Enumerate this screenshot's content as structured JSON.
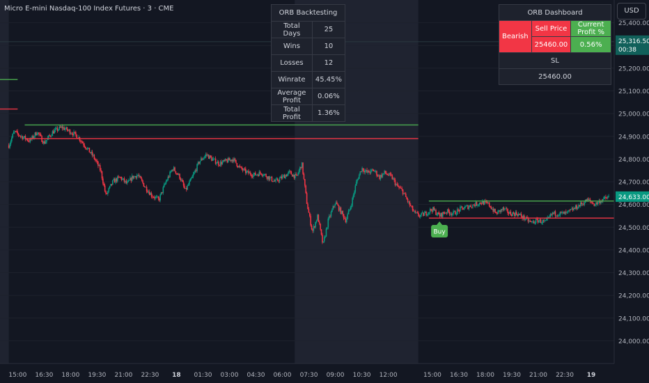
{
  "header": {
    "symbol_title": "Micro E-mini Nasdaq-100 Index Futures · 3 · CME",
    "currency_button": "USD"
  },
  "colors": {
    "background": "#131722",
    "session_shade": "#1f2330",
    "up_candle": "#089981",
    "down_candle": "#f23645",
    "range_high": "#4caf50",
    "range_low": "#f23645",
    "grid": "#1e222d"
  },
  "backtest": {
    "title": "ORB Backtesting",
    "rows": [
      {
        "label": "Total Days",
        "value": "25"
      },
      {
        "label": "Wins",
        "value": "10"
      },
      {
        "label": "Losses",
        "value": "12"
      },
      {
        "label": "Winrate",
        "value": "45.45%"
      },
      {
        "label": "Average Profit",
        "value": "0.06%"
      },
      {
        "label": "Total Profit",
        "value": "1.36%"
      }
    ]
  },
  "dashboard": {
    "title": "ORB Dashboard",
    "bias": "Bearish",
    "sell_price_label": "Sell Price",
    "current_profit_label": "Current Profit %",
    "sell_price": "25460.00",
    "current_profit": "0.56%",
    "sl_label": "SL",
    "sl_value": "25460.00"
  },
  "chart_data": {
    "type": "candlestick",
    "ylim": [
      23900,
      25500
    ],
    "y_ticks": [
      24000,
      24100,
      24200,
      24300,
      24400,
      24500,
      24600,
      24700,
      24800,
      24900,
      25000,
      25100,
      25200,
      25300,
      25400
    ],
    "y_tick_labels": [
      "24,000.00",
      "24,100.00",
      "24,200.00",
      "24,300.00",
      "24,400.00",
      "24,500.00",
      "24,600.00",
      "24,700.00",
      "24,800.00",
      "24,900.00",
      "25,000.00",
      "25,100.00",
      "25,200.00",
      "25,300.00",
      "25,400.00"
    ],
    "x_ticks": [
      {
        "t": 0.5,
        "label": "15:00"
      },
      {
        "t": 2.0,
        "label": "16:30"
      },
      {
        "t": 3.5,
        "label": "18:00"
      },
      {
        "t": 5.0,
        "label": "19:30"
      },
      {
        "t": 6.5,
        "label": "21:00"
      },
      {
        "t": 8.0,
        "label": "22:30"
      },
      {
        "t": 9.5,
        "label": "18"
      },
      {
        "t": 11.0,
        "label": "01:30"
      },
      {
        "t": 12.5,
        "label": "03:00"
      },
      {
        "t": 14.0,
        "label": "04:30"
      },
      {
        "t": 15.5,
        "label": "06:00"
      },
      {
        "t": 17.0,
        "label": "07:30"
      },
      {
        "t": 18.5,
        "label": "09:00"
      },
      {
        "t": 20.0,
        "label": "10:30"
      },
      {
        "t": 21.5,
        "label": "12:00"
      },
      {
        "t": 24.0,
        "label": "15:00"
      },
      {
        "t": 25.5,
        "label": "16:30"
      },
      {
        "t": 27.0,
        "label": "18:00"
      },
      {
        "t": 28.5,
        "label": "19:30"
      },
      {
        "t": 30.0,
        "label": "21:00"
      },
      {
        "t": 31.5,
        "label": "22:30"
      },
      {
        "t": 33.0,
        "label": "19"
      }
    ],
    "x_range": [
      -0.5,
      34.3
    ],
    "session_shades": [
      [
        -0.5,
        0.0
      ],
      [
        16.2,
        23.2
      ]
    ],
    "price_path": [
      [
        0.0,
        24860
      ],
      [
        0.3,
        24920
      ],
      [
        0.7,
        24900
      ],
      [
        1.2,
        24880
      ],
      [
        1.6,
        24920
      ],
      [
        2.0,
        24870
      ],
      [
        2.5,
        24920
      ],
      [
        3.0,
        24940
      ],
      [
        3.5,
        24920
      ],
      [
        3.9,
        24900
      ],
      [
        4.3,
        24860
      ],
      [
        4.8,
        24810
      ],
      [
        5.2,
        24750
      ],
      [
        5.5,
        24640
      ],
      [
        5.9,
        24700
      ],
      [
        6.3,
        24720
      ],
      [
        6.7,
        24690
      ],
      [
        7.0,
        24720
      ],
      [
        7.3,
        24730
      ],
      [
        7.7,
        24680
      ],
      [
        8.1,
        24640
      ],
      [
        8.5,
        24620
      ],
      [
        8.9,
        24700
      ],
      [
        9.3,
        24760
      ],
      [
        9.7,
        24720
      ],
      [
        10.0,
        24660
      ],
      [
        10.4,
        24720
      ],
      [
        10.8,
        24790
      ],
      [
        11.2,
        24820
      ],
      [
        11.5,
        24800
      ],
      [
        11.9,
        24780
      ],
      [
        12.3,
        24790
      ],
      [
        12.7,
        24800
      ],
      [
        13.1,
        24760
      ],
      [
        13.5,
        24740
      ],
      [
        13.9,
        24730
      ],
      [
        14.3,
        24740
      ],
      [
        14.7,
        24720
      ],
      [
        15.1,
        24700
      ],
      [
        15.5,
        24720
      ],
      [
        15.9,
        24740
      ],
      [
        16.3,
        24720
      ],
      [
        16.6,
        24780
      ],
      [
        16.9,
        24600
      ],
      [
        17.2,
        24480
      ],
      [
        17.5,
        24550
      ],
      [
        17.8,
        24420
      ],
      [
        18.1,
        24530
      ],
      [
        18.5,
        24610
      ],
      [
        18.8,
        24570
      ],
      [
        19.1,
        24530
      ],
      [
        19.4,
        24600
      ],
      [
        19.7,
        24700
      ],
      [
        20.0,
        24760
      ],
      [
        20.3,
        24740
      ],
      [
        20.7,
        24750
      ],
      [
        21.0,
        24720
      ],
      [
        21.3,
        24740
      ],
      [
        21.7,
        24720
      ],
      [
        22.0,
        24680
      ],
      [
        22.3,
        24660
      ],
      [
        22.7,
        24600
      ],
      [
        23.0,
        24560
      ],
      [
        23.3,
        24550
      ],
      [
        23.6,
        24560
      ],
      [
        24.0,
        24580
      ],
      [
        24.4,
        24550
      ],
      [
        24.8,
        24570
      ],
      [
        25.2,
        24560
      ],
      [
        25.6,
        24580
      ],
      [
        26.0,
        24590
      ],
      [
        26.4,
        24600
      ],
      [
        26.8,
        24610
      ],
      [
        27.2,
        24600
      ],
      [
        27.6,
        24560
      ],
      [
        28.0,
        24580
      ],
      [
        28.4,
        24560
      ],
      [
        28.8,
        24560
      ],
      [
        29.2,
        24540
      ],
      [
        29.6,
        24520
      ],
      [
        30.0,
        24530
      ],
      [
        30.4,
        24520
      ],
      [
        30.8,
        24560
      ],
      [
        31.2,
        24560
      ],
      [
        31.6,
        24560
      ],
      [
        32.0,
        24580
      ],
      [
        32.4,
        24600
      ],
      [
        32.8,
        24620
      ],
      [
        33.2,
        24600
      ],
      [
        33.6,
        24620
      ],
      [
        34.0,
        24633
      ]
    ],
    "range_lines": [
      {
        "kind": "high",
        "price": 25150,
        "x": [
          -0.5,
          0.5
        ]
      },
      {
        "kind": "low",
        "price": 25020,
        "x": [
          -0.5,
          0.5
        ]
      },
      {
        "kind": "high",
        "price": 24950,
        "x": [
          0.9,
          23.2
        ]
      },
      {
        "kind": "low",
        "price": 24890,
        "x": [
          0.9,
          23.2
        ]
      },
      {
        "kind": "high",
        "price": 24615,
        "x": [
          23.8,
          34.3
        ]
      },
      {
        "kind": "low",
        "price": 24540,
        "x": [
          23.8,
          34.3
        ]
      }
    ],
    "hline_price": 25316.5,
    "last_price": {
      "price": 24633,
      "label": "24,633.00"
    },
    "top_price": {
      "price": 25316.5,
      "label": "25,316.50",
      "countdown": "00:38"
    },
    "signals": [
      {
        "x": 24.4,
        "price": 24510,
        "label": "Buy"
      }
    ]
  }
}
